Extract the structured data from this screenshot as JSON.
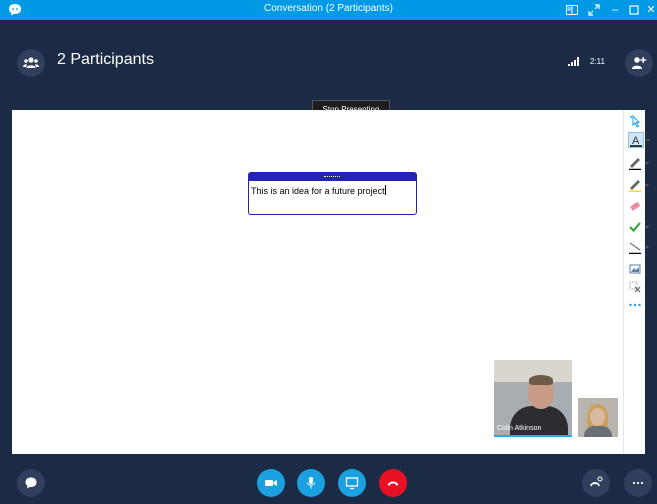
{
  "window": {
    "title": "Conversation (2 Participants)",
    "controls": [
      "layout-icon",
      "fullscreen-icon",
      "minimize-icon",
      "maximize-icon",
      "close-icon"
    ]
  },
  "header": {
    "participants_label": "2 Participants",
    "call_time": "2:11",
    "stop_presenting_label": "Stop Presenting"
  },
  "whiteboard": {
    "note_text": "This is an idea for a future project",
    "tools": [
      "select-pointer-icon",
      "text-tool-icon",
      "pen-icon",
      "highlighter-icon",
      "eraser-icon",
      "stamp-check-icon",
      "line-shape-icon",
      "insert-image-icon",
      "delete-selected-icon",
      "more-options-icon"
    ]
  },
  "video": {
    "remote_participant_name": "Colin Atkinson"
  },
  "bottom_bar": {
    "buttons": [
      "chat-button",
      "video-button",
      "mute-button",
      "share-screen-button",
      "hang-up-button",
      "call-controls-button",
      "more-button"
    ]
  },
  "colors": {
    "titlebar": "#0099e5",
    "background": "#1b2a45",
    "accent_blue": "#1ba1e2",
    "hangup_red": "#e81123",
    "note_blue": "#2323b8"
  }
}
